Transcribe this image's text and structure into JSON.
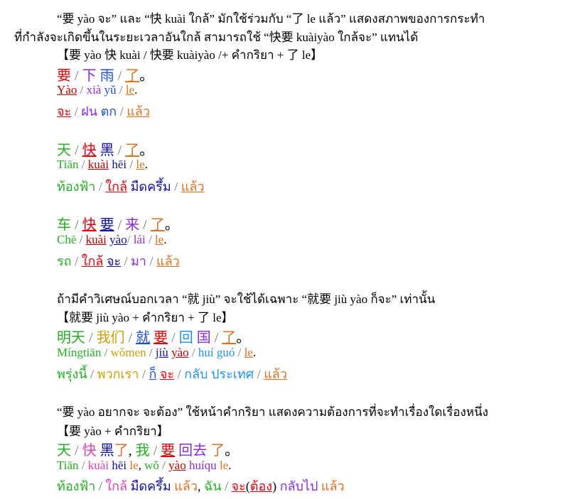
{
  "intro": {
    "line1": "“要 yào จะ” และ “快 kuài ใกล้” มักใช้ร่วมกับ “了 le แล้ว” แสดงสภาพของการกระทำ",
    "line2": "ที่กำลังจะเกิดขึ้นในระยะเวลาอันใกล้ สามารถใช้ “快要 kuàiyào ใกล้จะ” แทนได้"
  },
  "pattern1": "【要 yào  快 kuài / 快要 kuàiyào /+ คำกริยา + 了 le】",
  "ex1": {
    "zh": [
      "要",
      "下",
      "雨",
      "了",
      "。"
    ],
    "py": [
      "Yào",
      "xià",
      "yǔ",
      "le",
      "."
    ],
    "th": [
      "จะ",
      "ฝน",
      "ตก",
      "แล้ว"
    ]
  },
  "ex2": {
    "zh": [
      "天",
      "快",
      "黑",
      "了",
      "。"
    ],
    "py": [
      "Tiān",
      "kuài",
      "hēi",
      "le",
      "."
    ],
    "th": [
      "ท้องฟ้า",
      "ใกล้",
      "มืดครึ้ม",
      "แล้ว"
    ]
  },
  "ex3": {
    "zh": [
      "车",
      "快",
      "要",
      "来",
      "了",
      "。"
    ],
    "py": [
      "Chē",
      "kuài",
      "yào",
      "lái",
      "le",
      "."
    ],
    "th": [
      "รถ",
      "ใกล้",
      "จะ",
      "มา",
      "แล้ว"
    ]
  },
  "note2": "ถ้ามีคำวิเศษณ์บอกเวลา “就 jiù” จะใช้ได้เฉพาะ “就要 jiù yào ก็จะ” เท่านั้น",
  "pattern2": "【就要 jiù yào + คำกริยา + 了 le】",
  "ex4": {
    "zh": [
      "明天",
      "我们",
      "就",
      "要",
      "回",
      "国",
      "了",
      "。"
    ],
    "py": [
      "Míngtiān",
      "wǒmen",
      "jiù",
      "yào",
      "huí guó",
      "le",
      "."
    ],
    "th": [
      "พรุ่งนี้",
      "พวกเรา",
      "ก็",
      "จะ",
      "กลับ ประเทศ",
      "แล้ว"
    ]
  },
  "note3": "“要 yào อยากจะ จะต้อง” ใช้หน้าคำกริยา แสดงความต้องการที่จะทำเรื่องใดเรื่องหนึ่ง",
  "pattern3": "【要 yào + คำกริยา】",
  "ex5": {
    "zh": [
      "天",
      "快",
      "黑",
      "了",
      ",",
      "我",
      "要",
      "回去",
      "了",
      "。"
    ],
    "py": [
      "Tiān",
      "kuài",
      "hēi",
      "le",
      ",",
      "wǒ",
      "yào",
      "huíqu",
      "le",
      "."
    ],
    "th": [
      "ท้องฟ้า",
      "ใกล้",
      "มืดครึ้ม",
      "แล้ว",
      ",",
      "ฉัน",
      "จะ",
      "(",
      "ต้อง",
      ")",
      "กลับไป",
      "แล้ว"
    ]
  },
  "slash": "/"
}
